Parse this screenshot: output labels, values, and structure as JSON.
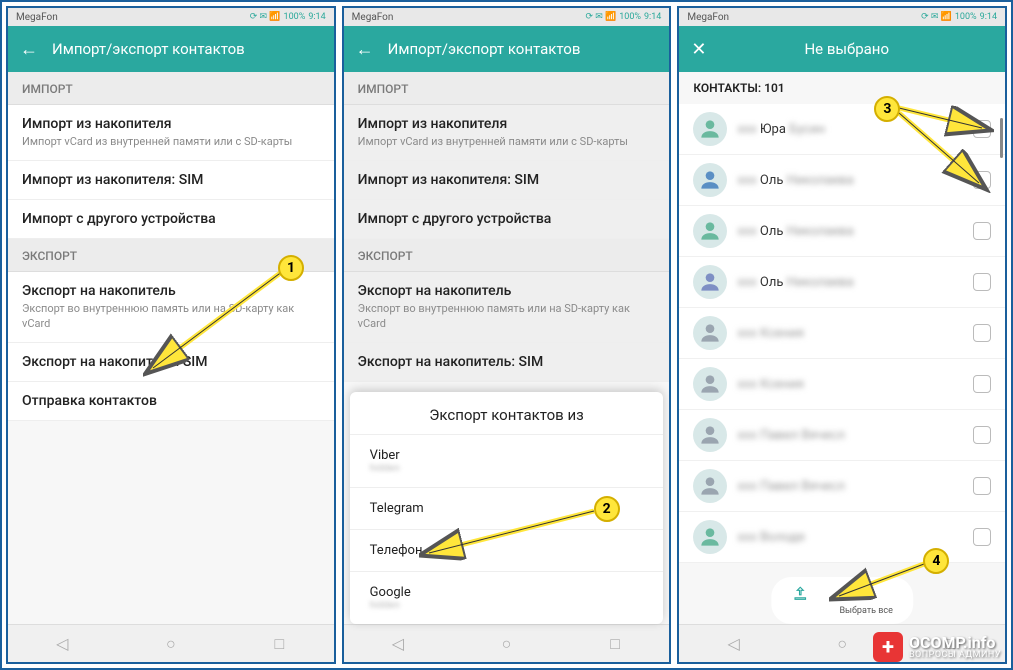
{
  "statusbar": {
    "carrier": "MegaFon",
    "battery": "100%",
    "time": "9:14"
  },
  "screen1": {
    "title": "Импорт/экспорт контактов",
    "sections": [
      {
        "header": "ИМПОРТ",
        "items": [
          {
            "primary": "Импорт из накопителя",
            "secondary": "Импорт vCard из внутренней памяти или с SD-карты"
          },
          {
            "primary": "Импорт из накопителя: SIM"
          },
          {
            "primary": "Импорт с другого устройства"
          }
        ]
      },
      {
        "header": "ЭКСПОРТ",
        "items": [
          {
            "primary": "Экспорт на накопитель",
            "secondary": "Экспорт во внутреннюю память или на SD-карту как vCard"
          },
          {
            "primary": "Экспорт на накопитель: SIM"
          },
          {
            "primary": "Отправка контактов"
          }
        ]
      }
    ]
  },
  "screen2": {
    "title": "Импорт/экспорт контактов",
    "sheet_title": "Экспорт контактов из",
    "sheet_items": [
      "Viber",
      "Telegram",
      "Телефон",
      "Google"
    ]
  },
  "screen3": {
    "title": "Не выбрано",
    "contacts_label": "КОНТАКТЫ: 101",
    "contacts": [
      {
        "name": "Юра",
        "rest": "Бусин"
      },
      {
        "name": "Оль",
        "rest": "Николаева"
      },
      {
        "name": "Оль",
        "rest": "Николаева"
      },
      {
        "name": "Оль",
        "rest": "Николаева"
      },
      {
        "name": "",
        "rest": "Ксения"
      },
      {
        "name": "",
        "rest": "Ксения"
      },
      {
        "name": "",
        "rest": "Павел Вячесл"
      },
      {
        "name": "",
        "rest": "Павел Вячесл"
      },
      {
        "name": "",
        "rest": "Володя"
      }
    ],
    "select_all": "Выбрать все"
  },
  "avatar_colors": [
    "#6ab99f",
    "#5a8fc4",
    "#6ab99f",
    "#7e8fc4",
    "#9aa5b0",
    "#9aa5b0",
    "#9aa5b0",
    "#9aa5b0",
    "#6ab99f"
  ],
  "watermark": {
    "brand": "OCOMP.info",
    "sub": "ВОПРОСЫ АДМИНУ"
  }
}
